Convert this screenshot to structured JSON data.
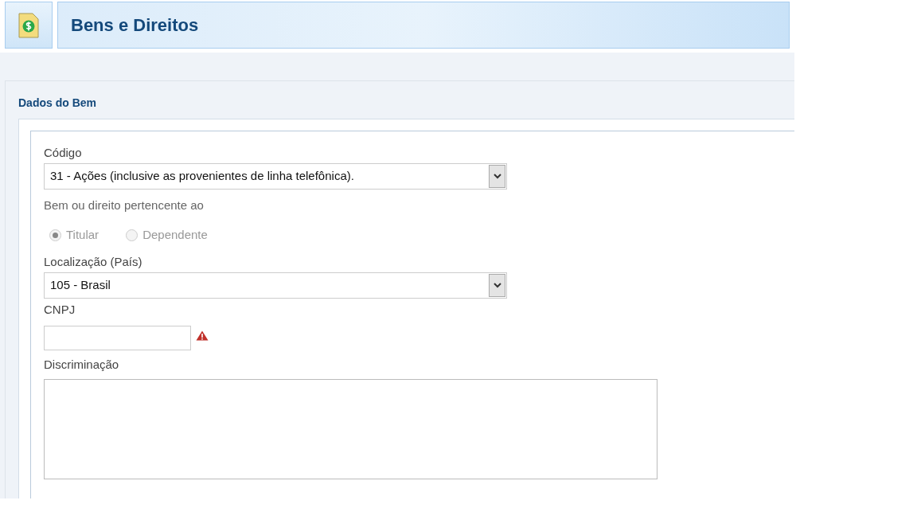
{
  "header": {
    "title": "Bens e Direitos"
  },
  "section": {
    "title": "Dados do Bem"
  },
  "fields": [
    {
      "kind": "select",
      "label": "Código",
      "value": "31 - Ações (inclusive as provenientes de linha telefônica)."
    },
    {
      "kind": "radio",
      "label": "Bem ou direito pertencente ao",
      "options": [
        {
          "label": "Titular",
          "selected": true,
          "disabled": true
        },
        {
          "label": "Dependente",
          "selected": false,
          "disabled": true
        }
      ]
    },
    {
      "kind": "select",
      "label": "Localização (País)",
      "value": "105 - Brasil"
    },
    {
      "kind": "input",
      "label": "CNPJ",
      "error": true
    },
    {
      "kind": "textarea",
      "label": "Discriminação"
    }
  ]
}
